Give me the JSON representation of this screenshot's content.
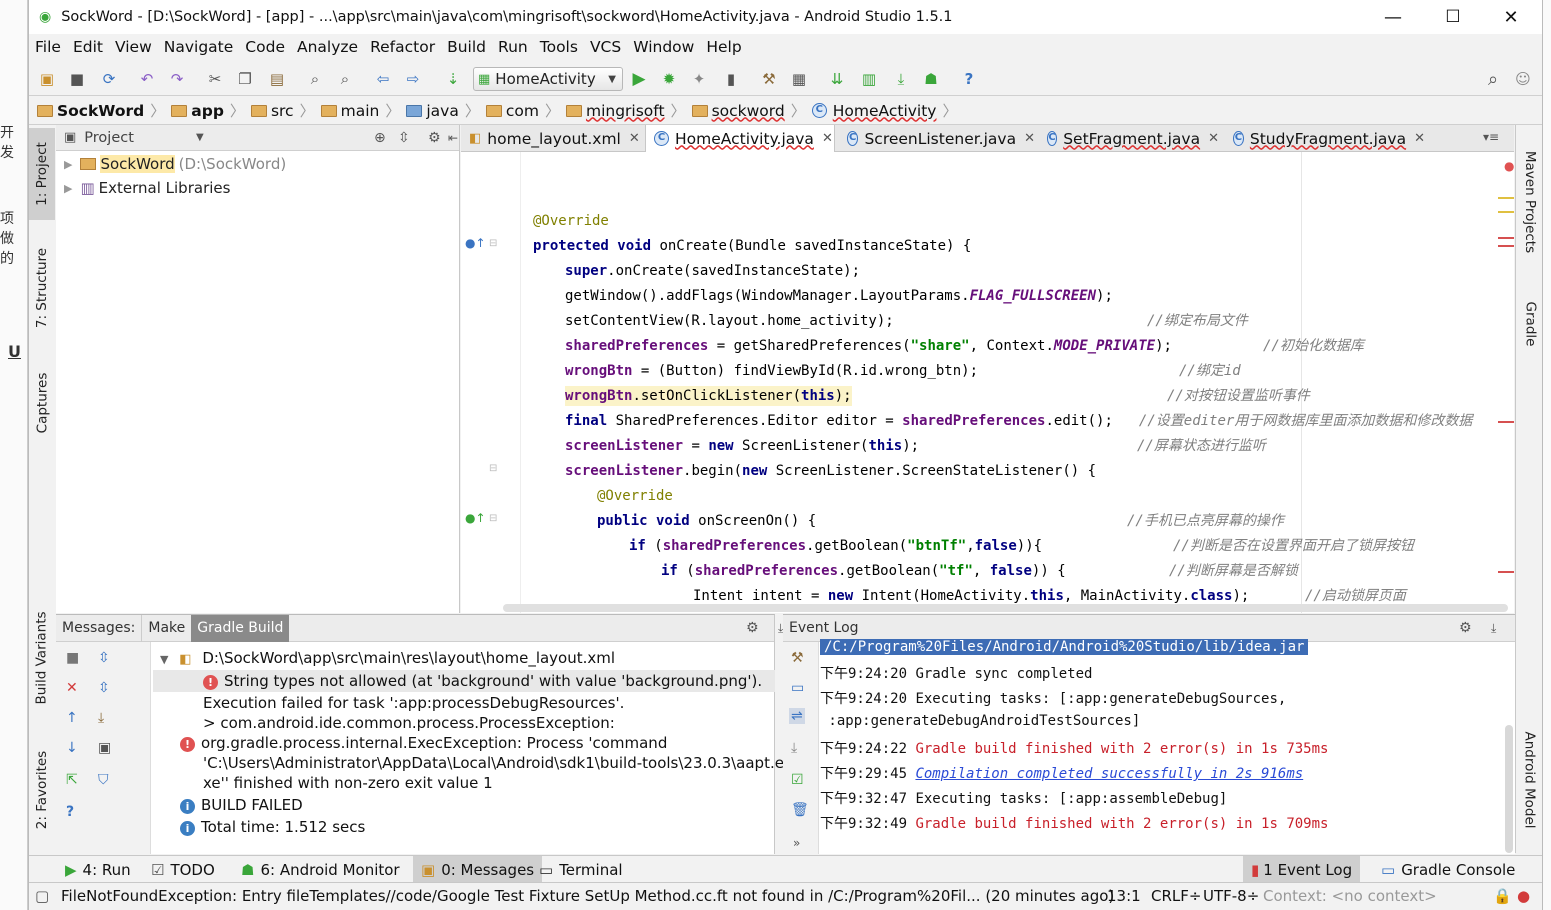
{
  "window": {
    "title": "SockWord - [D:\\SockWord] - [app] - ...\\app\\src\\main\\java\\com\\mingrisoft\\sockword\\HomeActivity.java - Android Studio 1.5.1",
    "minimize": "—",
    "maximize": "☐",
    "close": "✕"
  },
  "background_fragments": [
    "开发",
    "项做的",
    "U"
  ],
  "menu": [
    "File",
    "Edit",
    "View",
    "Navigate",
    "Code",
    "Analyze",
    "Refactor",
    "Build",
    "Run",
    "Tools",
    "VCS",
    "Window",
    "Help"
  ],
  "toolbar": {
    "run_config": "HomeActivity",
    "help": "?"
  },
  "breadcrumb": [
    "SockWord",
    "app",
    "src",
    "main",
    "java",
    "com",
    "mingrisoft",
    "sockword",
    "HomeActivity"
  ],
  "left_tabs": [
    "1: Project",
    "7: Structure",
    "Captures",
    "Build Variants",
    "2: Favorites"
  ],
  "right_tabs": [
    "Maven Projects",
    "Gradle",
    "Android Model"
  ],
  "project": {
    "view_label": "Project",
    "root_name": "SockWord",
    "root_path": "(D:\\SockWord)",
    "libraries": "External Libraries"
  },
  "editor_tabs": [
    {
      "label": "home_layout.xml",
      "close": "✕"
    },
    {
      "label": "HomeActivity.java",
      "close": "✕"
    },
    {
      "label": "ScreenListener.java",
      "close": "✕"
    },
    {
      "label": "SetFragment.java",
      "close": "✕"
    },
    {
      "label": "StudyFragment.java",
      "close": "✕"
    }
  ],
  "code": {
    "l1": "@Override",
    "l2a": "protected void",
    "l2b": " onCreate(Bundle savedInstanceState) {",
    "l3a": "super",
    "l3b": ".onCreate(savedInstanceState);",
    "l4a": "getWindow().addFlags(WindowManager.LayoutParams.",
    "l4b": "FLAG_FULLSCREEN",
    "l4c": ");",
    "l5a": "setContentView(R.layout.home_activity);",
    "l5c": "//绑定布局文件",
    "l6a": "sharedPreferences",
    "l6b": " = getSharedPreferences(",
    "l6c": "\"share\"",
    "l6d": ", Context.",
    "l6e": "MODE_PRIVATE",
    "l6f": ");",
    "l6g": "//初始化数据库",
    "l7a": "wrongBtn",
    "l7b": " = (Button) findViewById(R.id.wrong_btn);",
    "l7c": "//绑定id",
    "l8a": "wrongBtn",
    "l8b": ".setOnClickListener(",
    "l8c": "this",
    "l8d": ");",
    "l8e": "//对按钮设置监听事件",
    "l9a": "final",
    "l9b": " SharedPreferences.Editor editor = ",
    "l9c": "sharedPreferences",
    "l9d": ".edit();",
    "l9e": "//设置editer用于网数据库里面添加数据和修改数据",
    "l10a": "screenListener",
    "l10b": " = ",
    "l10c": "new",
    "l10d": " ScreenListener(",
    "l10e": "this",
    "l10f": ");",
    "l10g": "//屏幕状态进行监听",
    "l11a": "screenListener",
    "l11b": ".begin(",
    "l11c": "new",
    "l11d": " ScreenListener.ScreenStateListener() {",
    "l12": "@Override",
    "l13a": "public void",
    "l13b": " onScreenOn() {",
    "l13c": "//手机已点亮屏幕的操作",
    "l14a": "if",
    "l14b": " (",
    "l14c": "sharedPreferences",
    "l14d": ".getBoolean(",
    "l14e": "\"btnTf\"",
    "l14f": ",",
    "l14g": "false",
    "l14h": ")){",
    "l14i": "//判断是否在设置界面开启了锁屏按钮",
    "l15a": "if",
    "l15b": " (",
    "l15c": "sharedPreferences",
    "l15d": ".getBoolean(",
    "l15e": "\"tf\"",
    "l15f": ", ",
    "l15g": "false",
    "l15h": ")) {",
    "l15i": "//判断屏幕是否解锁",
    "l16a": "Intent intent = ",
    "l16b": "new",
    "l16c": " Intent(HomeActivity.",
    "l16d": "this",
    "l16e": ", MainActivity.",
    "l16f": "class",
    "l16g": ");",
    "l16h": "//启动锁屏页面"
  },
  "messages": {
    "label": "Messages:",
    "tabs": [
      "Make",
      "Gradle Build"
    ],
    "file": "D:\\SockWord\\app\\src\\main\\res\\layout\\home_layout.xml",
    "error1": "String types not allowed (at 'background' with value 'background.png').",
    "line2": "Execution failed for task ':app:processDebugResources'.",
    "line3": "> com.android.ide.common.process.ProcessException:",
    "line4": "org.gradle.process.internal.ExecException: Process 'command",
    "line5": "'C:\\Users\\Administrator\\AppData\\Local\\Android\\sdk1\\build-tools\\23.0.3\\aapt.e",
    "line6": "xe'' finished with non-zero exit value 1",
    "build_failed": "BUILD FAILED",
    "total_time": "Total time: 1.512 secs"
  },
  "event_log": {
    "label": "Event Log",
    "top_line": "/C:/Program%20Files/Android/Android%20Studio/lib/idea.jar",
    "entries": [
      {
        "time": "下午9:24:20",
        "text": "Gradle sync completed",
        "style": "normal"
      },
      {
        "time": "下午9:24:20",
        "text": "Executing tasks: [:app:generateDebugSources,",
        "style": "normal"
      },
      {
        "time": "",
        "text": " :app:generateDebugAndroidTestSources]",
        "style": "normal"
      },
      {
        "time": "下午9:24:22",
        "text": "Gradle build finished with 2 error(s) in 1s 735ms",
        "style": "red"
      },
      {
        "time": "下午9:29:45",
        "text": "Compilation completed successfully in 2s 916ms",
        "style": "link"
      },
      {
        "time": "下午9:32:47",
        "text": "Executing tasks: [:app:assembleDebug]",
        "style": "normal"
      },
      {
        "time": "下午9:32:49",
        "text": "Gradle build finished with 2 error(s) in 1s 709ms",
        "style": "red"
      }
    ]
  },
  "bottom_tabs": {
    "run": "4: Run",
    "todo": "TODO",
    "monitor": "6: Android Monitor",
    "messages": "0: Messages",
    "terminal": "Terminal",
    "event_log": "1 Event Log",
    "gradle_console": "Gradle Console"
  },
  "status": {
    "message": "FileNotFoundException: Entry fileTemplates//code/Google Test Fixture SetUp Method.cc.ft not found in /C:/Program%20Fil... (20 minutes ago)",
    "position": "13:1",
    "line_sep": "CRLF÷",
    "encoding": "UTF-8÷",
    "context": "Context: <no context>"
  }
}
